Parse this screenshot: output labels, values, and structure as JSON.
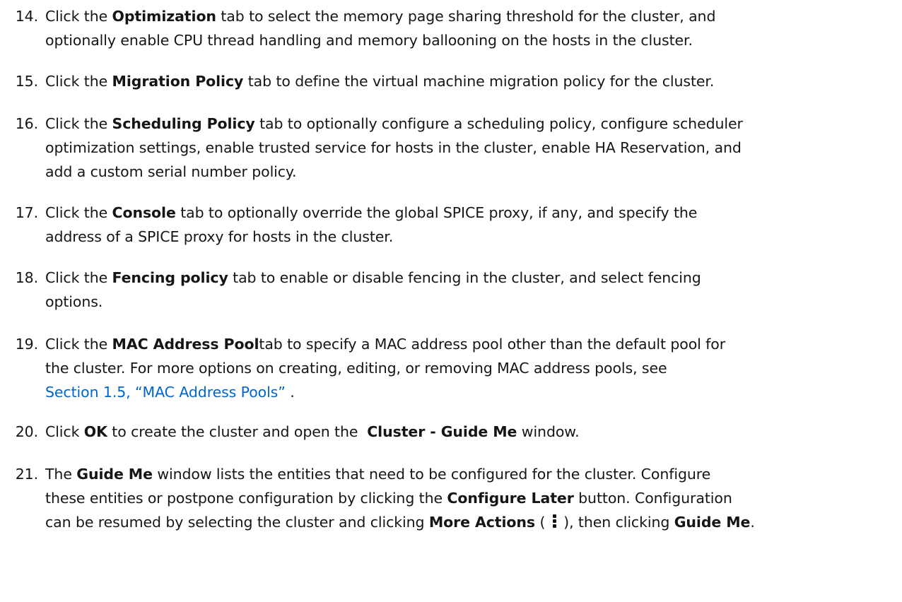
{
  "steps": [
    {
      "num": "14.",
      "lines": [
        [
          {
            "t": "Click the "
          },
          {
            "t": "Optimization",
            "b": true
          },
          {
            "t": " tab to select the memory page sharing threshold for the cluster, and"
          }
        ],
        [
          {
            "t": "optionally enable CPU thread handling and memory ballooning on the hosts in the cluster."
          }
        ]
      ]
    },
    {
      "num": "15.",
      "lines": [
        [
          {
            "t": "Click the "
          },
          {
            "t": "Migration Policy",
            "b": true
          },
          {
            "t": " tab to define the virtual machine migration policy for the cluster."
          }
        ]
      ]
    },
    {
      "num": "16.",
      "lines": [
        [
          {
            "t": "Click the "
          },
          {
            "t": "Scheduling Policy",
            "b": true
          },
          {
            "t": " tab to optionally configure a scheduling policy, configure scheduler"
          }
        ],
        [
          {
            "t": "optimization settings, enable trusted service for hosts in the cluster, enable HA Reservation, and"
          }
        ],
        [
          {
            "t": "add a custom serial number policy."
          }
        ]
      ]
    },
    {
      "num": "17.",
      "lines": [
        [
          {
            "t": "Click the "
          },
          {
            "t": "Console",
            "b": true
          },
          {
            "t": " tab to optionally override the global SPICE proxy, if any, and specify the"
          }
        ],
        [
          {
            "t": "address of a SPICE proxy for hosts in the cluster."
          }
        ]
      ]
    },
    {
      "num": "18.",
      "lines": [
        [
          {
            "t": "Click the "
          },
          {
            "t": "Fencing policy",
            "b": true
          },
          {
            "t": " tab to enable or disable fencing in the cluster, and select fencing"
          }
        ],
        [
          {
            "t": "options."
          }
        ]
      ]
    },
    {
      "num": "19.",
      "lines": [
        [
          {
            "t": "Click the "
          },
          {
            "t": "MAC Address Pool",
            "b": true
          },
          {
            "t": "tab to specify a MAC address pool other than the default pool for"
          }
        ],
        [
          {
            "t": "the cluster. For more options on creating, editing, or removing MAC address pools, see"
          }
        ],
        [
          {
            "t": "Section 1.5, “MAC Address Pools” ",
            "link": true
          },
          {
            "t": "."
          }
        ]
      ]
    },
    {
      "num": "20.",
      "lines": [
        [
          {
            "t": "Click "
          },
          {
            "t": "OK",
            "b": true
          },
          {
            "t": " to create the cluster and open the  "
          },
          {
            "t": "Cluster - Guide Me",
            "b": true
          },
          {
            "t": " window."
          }
        ]
      ]
    },
    {
      "num": "21.",
      "lines": [
        [
          {
            "t": "The "
          },
          {
            "t": "Guide Me",
            "b": true
          },
          {
            "t": " window lists the entities that need to be configured for the cluster. Configure"
          }
        ],
        [
          {
            "t": "these entities or postpone configuration by clicking the "
          },
          {
            "t": "Configure Later",
            "b": true
          },
          {
            "t": " button. Configuration"
          }
        ],
        [
          {
            "t": "can be resumed by selecting the cluster and clicking "
          },
          {
            "t": "More Actions",
            "b": true
          },
          {
            "t": " ( "
          },
          {
            "icon": "kebab-icon"
          },
          {
            "t": " ), then clicking "
          },
          {
            "t": "Guide Me",
            "b": true
          },
          {
            "t": "."
          }
        ]
      ]
    }
  ]
}
